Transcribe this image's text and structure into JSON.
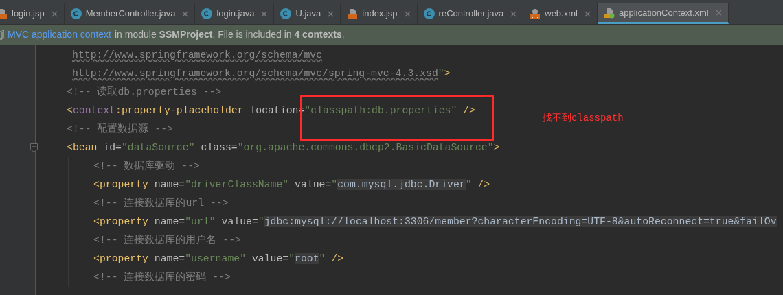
{
  "tabs": [
    {
      "label": "login.jsp",
      "kind": "jsp-orange",
      "selected": false
    },
    {
      "label": "MemberController.java",
      "kind": "class",
      "selected": false
    },
    {
      "label": "login.java",
      "kind": "class",
      "selected": false
    },
    {
      "label": "U.java",
      "kind": "class",
      "selected": false
    },
    {
      "label": "index.jsp",
      "kind": "jsp",
      "selected": false
    },
    {
      "label": "reController.java",
      "kind": "class",
      "selected": false
    },
    {
      "label": "web.xml",
      "kind": "web-xml",
      "selected": false
    },
    {
      "label": "applicationContext.xml",
      "kind": "spring-xml",
      "selected": true
    }
  ],
  "info_bar": {
    "link": "MVC application context",
    "text": "in module **SSMProject**. File is included in **4 contexts**."
  },
  "code": [
    {
      "tokens": [
        {
          "kind": "url",
          "text": "http://www.springframework.org/schema/mvc"
        }
      ]
    },
    {
      "tokens": [
        {
          "kind": "url",
          "text": "http://www.springframework.org/schema/mvc/spring-mvc-4.3.xsd"
        },
        {
          "kind": "value",
          "text": "\""
        },
        {
          "kind": "bracket",
          "text": ">"
        }
      ]
    },
    {
      "tokens": [
        {
          "kind": "comment",
          "text": "<!-- 读取db.properties -->"
        }
      ]
    },
    {
      "tokens": [
        {
          "kind": "bracket",
          "text": "<"
        },
        {
          "kind": "ns",
          "text": "context"
        },
        {
          "kind": "bracket",
          "text": ":"
        },
        {
          "kind": "tag",
          "text": "property-placeholder"
        },
        {
          "kind": "attr",
          "text": " location="
        },
        {
          "kind": "value",
          "text": "\"classpath:db.properties\""
        },
        {
          "kind": "bracket",
          "text": " />"
        }
      ]
    },
    {
      "tokens": [
        {
          "kind": "comment",
          "text": "<!-- 配置数据源 -->"
        }
      ]
    },
    {
      "tokens": [
        {
          "kind": "bracket",
          "text": "<"
        },
        {
          "kind": "tag",
          "text": "bean"
        },
        {
          "kind": "attr",
          "text": " id="
        },
        {
          "kind": "value",
          "text": "\"dataSource\""
        },
        {
          "kind": "attr",
          "text": " class="
        },
        {
          "kind": "value",
          "text": "\"org.apache.commons.dbcp2.BasicDataSource\""
        },
        {
          "kind": "bracket",
          "text": ">"
        }
      ],
      "children": [
        {
          "tokens": [
            {
              "kind": "comment",
              "text": "<!-- 数据库驱动 -->"
            }
          ]
        },
        {
          "tokens": [
            {
              "kind": "bracket",
              "text": "<"
            },
            {
              "kind": "tag",
              "text": "property"
            },
            {
              "kind": "attr",
              "text": " name="
            },
            {
              "kind": "value",
              "text": "\"driverClassName\""
            },
            {
              "kind": "attr",
              "text": " value="
            },
            {
              "kind": "value",
              "text": "\""
            },
            {
              "kind": "injected",
              "text": "com.mysql.jdbc.Driver"
            },
            {
              "kind": "value",
              "text": "\""
            },
            {
              "kind": "bracket",
              "text": " />"
            }
          ]
        },
        {
          "tokens": [
            {
              "kind": "comment",
              "text": "<!-- 连接数据库的url -->"
            }
          ]
        },
        {
          "tokens": [
            {
              "kind": "bracket",
              "text": "<"
            },
            {
              "kind": "tag",
              "text": "property"
            },
            {
              "kind": "attr",
              "text": " name="
            },
            {
              "kind": "value",
              "text": "\"url\""
            },
            {
              "kind": "attr",
              "text": " value="
            },
            {
              "kind": "value",
              "text": "\""
            },
            {
              "kind": "injected",
              "text": "jdbc:mysql://localhost:3306/member?characterEncoding=UTF-8&autoReconnect=true&failOv"
            }
          ]
        },
        {
          "tokens": [
            {
              "kind": "comment",
              "text": "<!-- 连接数据库的用户名 -->"
            }
          ]
        },
        {
          "tokens": [
            {
              "kind": "bracket",
              "text": "<"
            },
            {
              "kind": "tag",
              "text": "property"
            },
            {
              "kind": "attr",
              "text": " name="
            },
            {
              "kind": "value",
              "text": "\"username\""
            },
            {
              "kind": "attr",
              "text": " value="
            },
            {
              "kind": "value",
              "text": "\""
            },
            {
              "kind": "injected",
              "text": "root"
            },
            {
              "kind": "value",
              "text": "\""
            },
            {
              "kind": "bracket",
              "text": " />"
            }
          ]
        },
        {
          "tokens": [
            {
              "kind": "comment",
              "text": "<!-- 连接数据库的密码 -->"
            }
          ]
        }
      ]
    }
  ],
  "annotation": {
    "note": "找不到classpath"
  }
}
